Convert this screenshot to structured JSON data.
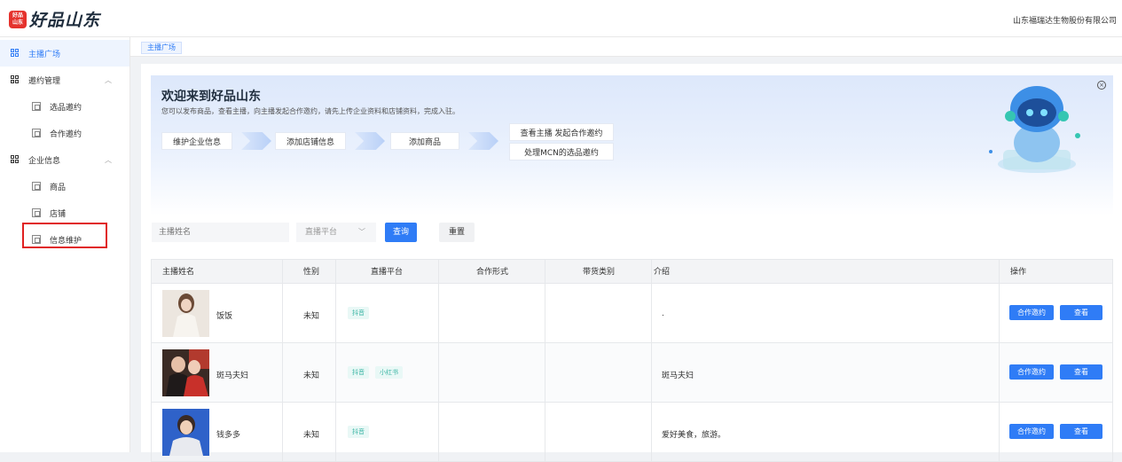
{
  "header": {
    "logo_badge_line1": "好品",
    "logo_badge_line2": "山东",
    "logo_text": "好品山东",
    "company": "山东福瑞达生物股份有限公司"
  },
  "sidebar": {
    "items": [
      {
        "label": "主播广场"
      },
      {
        "label": "邀约管理"
      },
      {
        "label": "选品邀约"
      },
      {
        "label": "合作邀约"
      },
      {
        "label": "企业信息"
      },
      {
        "label": "商品"
      },
      {
        "label": "店铺"
      },
      {
        "label": "信息维护"
      }
    ]
  },
  "breadcrumb": {
    "label": "主播广场"
  },
  "banner": {
    "title": "欢迎来到好品山东",
    "subtitle": "您可以发布商品，查看主播，向主播发起合作邀约，请先上传企业资料和店铺资料，完成入驻。",
    "steps": [
      "维护企业信息",
      "添加店铺信息",
      "添加商品",
      "查看主播 发起合作邀约",
      "处理MCN的选品邀约"
    ]
  },
  "search": {
    "placeholder": "主播姓名",
    "platform_placeholder": "直播平台",
    "query_label": "查询",
    "reset_label": "重置"
  },
  "table": {
    "columns": [
      "主播姓名",
      "性别",
      "直播平台",
      "合作形式",
      "带货类别",
      "介绍",
      "操作"
    ],
    "rows": [
      {
        "name": "饭饭",
        "gender": "未知",
        "platforms": [
          "抖音"
        ],
        "intro": ".",
        "coop_label": "合作邀约",
        "view_label": "查看"
      },
      {
        "name": "斑马夫妇",
        "gender": "未知",
        "platforms": [
          "抖音",
          "小红书"
        ],
        "intro": "斑马夫妇",
        "coop_label": "合作邀约",
        "view_label": "查看"
      },
      {
        "name": "钱多多",
        "gender": "未知",
        "platforms": [
          "抖音"
        ],
        "intro": "爱好美食，旅游。",
        "coop_label": "合作邀约",
        "view_label": "查看"
      }
    ]
  },
  "colors": {
    "accent": "#2f7cf6",
    "brand_red": "#e5322d",
    "tag_green": "#3ab5a4",
    "highlight_box": "#e02020"
  }
}
